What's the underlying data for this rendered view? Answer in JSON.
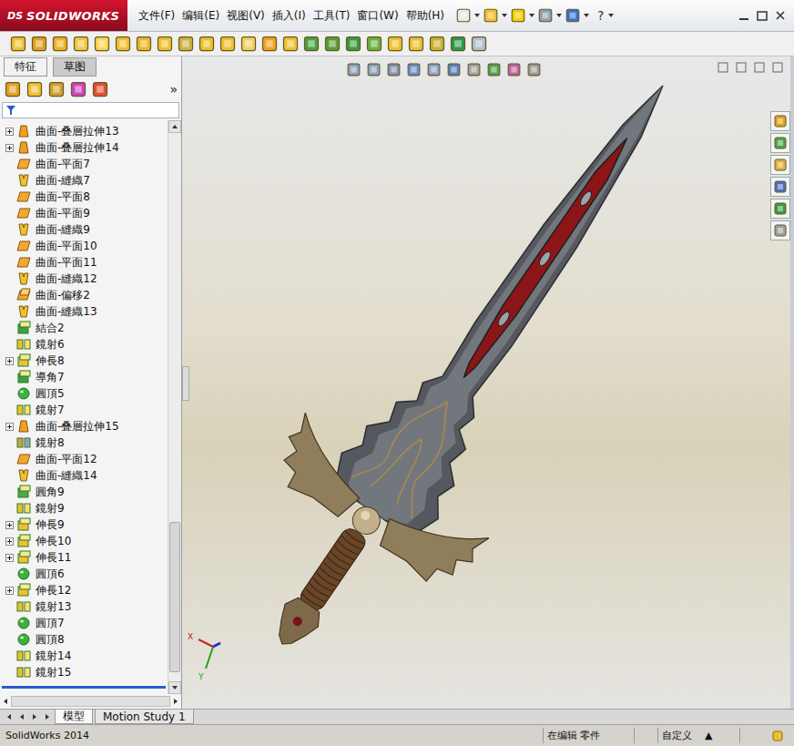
{
  "app": {
    "logo_mark": "DS",
    "logo": "SOLIDWORKS"
  },
  "menus": [
    "文件(F)",
    "编辑(E)",
    "视图(V)",
    "插入(I)",
    "工具(T)",
    "窗口(W)",
    "帮助(H)"
  ],
  "help_glyph": "?",
  "panel": {
    "tabs": [
      {
        "label": "特征",
        "selected": false
      },
      {
        "label": "草图",
        "selected": true
      }
    ],
    "collapse_glyph": "»",
    "items": [
      {
        "label": "曲面-叠層拉伸13",
        "kind": "loft",
        "expandable": true,
        "expanded": false
      },
      {
        "label": "曲面-叠層拉伸14",
        "kind": "loft",
        "expandable": true,
        "expanded": false
      },
      {
        "label": "曲面-平面7",
        "kind": "plane",
        "expandable": false,
        "expanded": false
      },
      {
        "label": "曲面-縫織7",
        "kind": "knit",
        "expandable": false,
        "expanded": false
      },
      {
        "label": "曲面-平面8",
        "kind": "plane",
        "expandable": false,
        "expanded": false
      },
      {
        "label": "曲面-平面9",
        "kind": "plane",
        "expandable": false,
        "expanded": false
      },
      {
        "label": "曲面-縫織9",
        "kind": "knit",
        "expandable": false,
        "expanded": false
      },
      {
        "label": "曲面-平面10",
        "kind": "plane",
        "expandable": false,
        "expanded": false
      },
      {
        "label": "曲面-平面11",
        "kind": "plane",
        "expandable": false,
        "expanded": false
      },
      {
        "label": "曲面-縫織12",
        "kind": "knit",
        "expandable": false,
        "expanded": false
      },
      {
        "label": "曲面-偏移2",
        "kind": "offset",
        "expandable": false,
        "expanded": false
      },
      {
        "label": "曲面-縫織13",
        "kind": "knit",
        "expandable": false,
        "expanded": false
      },
      {
        "label": "結合2",
        "kind": "combine",
        "expandable": false,
        "expanded": false
      },
      {
        "label": "鏡射6",
        "kind": "mirror",
        "expandable": false,
        "expanded": false
      },
      {
        "label": "伸長8",
        "kind": "extrude",
        "expandable": true,
        "expanded": false
      },
      {
        "label": "導角7",
        "kind": "chamfer",
        "expandable": false,
        "expanded": false
      },
      {
        "label": "圓頂5",
        "kind": "dome",
        "expandable": false,
        "expanded": false
      },
      {
        "label": "鏡射7",
        "kind": "mirror",
        "expandable": false,
        "expanded": false
      },
      {
        "label": "曲面-叠層拉伸15",
        "kind": "loft",
        "expandable": true,
        "expanded": false
      },
      {
        "label": "鏡射8",
        "kind": "mirror2",
        "expandable": false,
        "expanded": false
      },
      {
        "label": "曲面-平面12",
        "kind": "plane",
        "expandable": false,
        "expanded": false
      },
      {
        "label": "曲面-縫織14",
        "kind": "knit",
        "expandable": false,
        "expanded": false
      },
      {
        "label": "圓角9",
        "kind": "fillet",
        "expandable": false,
        "expanded": false
      },
      {
        "label": "鏡射9",
        "kind": "mirror",
        "expandable": false,
        "expanded": false
      },
      {
        "label": "伸長9",
        "kind": "extrude",
        "expandable": true,
        "expanded": false
      },
      {
        "label": "伸長10",
        "kind": "extrude",
        "expandable": true,
        "expanded": false
      },
      {
        "label": "伸長11",
        "kind": "extrude",
        "expandable": true,
        "expanded": false
      },
      {
        "label": "圓頂6",
        "kind": "dome",
        "expandable": false,
        "expanded": false
      },
      {
        "label": "伸長12",
        "kind": "extrude",
        "expandable": true,
        "expanded": false
      },
      {
        "label": "鏡射13",
        "kind": "mirror",
        "expandable": false,
        "expanded": false
      },
      {
        "label": "圓頂7",
        "kind": "dome",
        "expandable": false,
        "expanded": false
      },
      {
        "label": "圓頂8",
        "kind": "dome",
        "expandable": false,
        "expanded": false
      },
      {
        "label": "鏡射14",
        "kind": "mirror",
        "expandable": false,
        "expanded": false
      },
      {
        "label": "鏡射15",
        "kind": "mirror",
        "expandable": false,
        "expanded": false
      }
    ],
    "scrollbar": {
      "start": 0.71,
      "size": 0.27
    }
  },
  "bottom_tabs": [
    {
      "label": "模型",
      "selected": true
    },
    {
      "label": "Motion Study 1",
      "selected": false
    }
  ],
  "axes": {
    "x": "X",
    "y": "Y"
  },
  "status_bar": {
    "app": "SolidWorks 2014",
    "mode": "在编辑 零件",
    "units": "自定义",
    "units_glyph": "▲"
  }
}
